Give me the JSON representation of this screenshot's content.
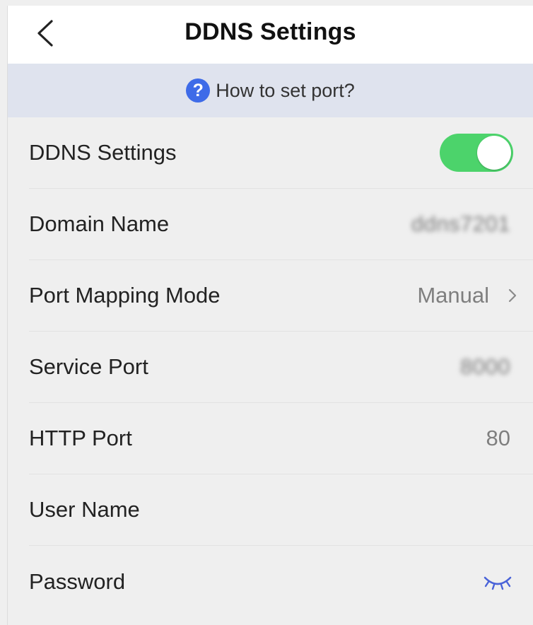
{
  "header": {
    "title": "DDNS Settings",
    "back_icon": "chevron-left-icon"
  },
  "help": {
    "icon": "question-circle-icon",
    "text": "How to set port?"
  },
  "colors": {
    "toggle_on": "#4cd36b",
    "accent": "#3e6be8",
    "help_bar_bg": "#dfe3ee"
  },
  "settings": {
    "ddns": {
      "label": "DDNS Settings",
      "enabled": true
    },
    "domain_name": {
      "label": "Domain Name",
      "value": "ddns7201"
    },
    "port_mapping_mode": {
      "label": "Port Mapping Mode",
      "value": "Manual"
    },
    "service_port": {
      "label": "Service Port",
      "value": "8000"
    },
    "http_port": {
      "label": "HTTP Port",
      "value": "80"
    },
    "user_name": {
      "label": "User Name",
      "value": ""
    },
    "password": {
      "label": "Password",
      "icon": "eye-closed-icon"
    }
  }
}
